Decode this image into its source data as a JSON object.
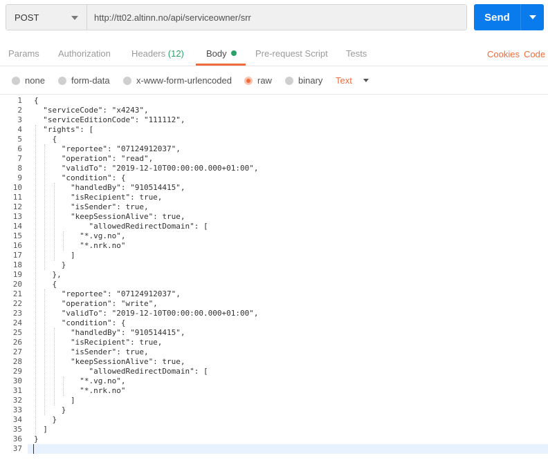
{
  "request": {
    "method": "POST",
    "url": "http://tt02.altinn.no/api/serviceowner/srr",
    "send_label": "Send"
  },
  "tabs": {
    "params": "Params",
    "authorization": "Authorization",
    "headers": "Headers",
    "headers_count": "(12)",
    "body": "Body",
    "prerequest": "Pre-request Script",
    "tests": "Tests",
    "cookies": "Cookies",
    "code": "Code"
  },
  "body_types": {
    "none": "none",
    "form_data": "form-data",
    "urlencoded": "x-www-form-urlencoded",
    "raw": "raw",
    "binary": "binary",
    "selected": "raw",
    "format": "Text"
  },
  "editor": {
    "current_line": 37,
    "lines": [
      "{",
      "  \"serviceCode\": \"x4243\",",
      "  \"serviceEditionCode\": \"111112\",",
      "  \"rights\": [",
      "    {",
      "      \"reportee\": \"07124912037\",",
      "      \"operation\": \"read\",",
      "      \"validTo\": \"2019-12-10T00:00:00.000+01:00\",",
      "      \"condition\": {",
      "        \"handledBy\": \"910514415\",",
      "        \"isRecipient\": true,",
      "        \"isSender\": true,",
      "        \"keepSessionAlive\": true,",
      "            \"allowedRedirectDomain\": [",
      "          \"*.vg.no\",",
      "          \"*.nrk.no\"",
      "        ]",
      "      }",
      "    },",
      "    {",
      "      \"reportee\": \"07124912037\",",
      "      \"operation\": \"write\",",
      "      \"validTo\": \"2019-12-10T00:00:00.000+01:00\",",
      "      \"condition\": {",
      "        \"handledBy\": \"910514415\",",
      "        \"isRecipient\": true,",
      "        \"isSender\": true,",
      "        \"keepSessionAlive\": true,",
      "            \"allowedRedirectDomain\": [",
      "          \"*.vg.no\",",
      "          \"*.nrk.no\"",
      "        ]",
      "      }",
      "    }",
      "  ]",
      "}",
      ""
    ]
  }
}
